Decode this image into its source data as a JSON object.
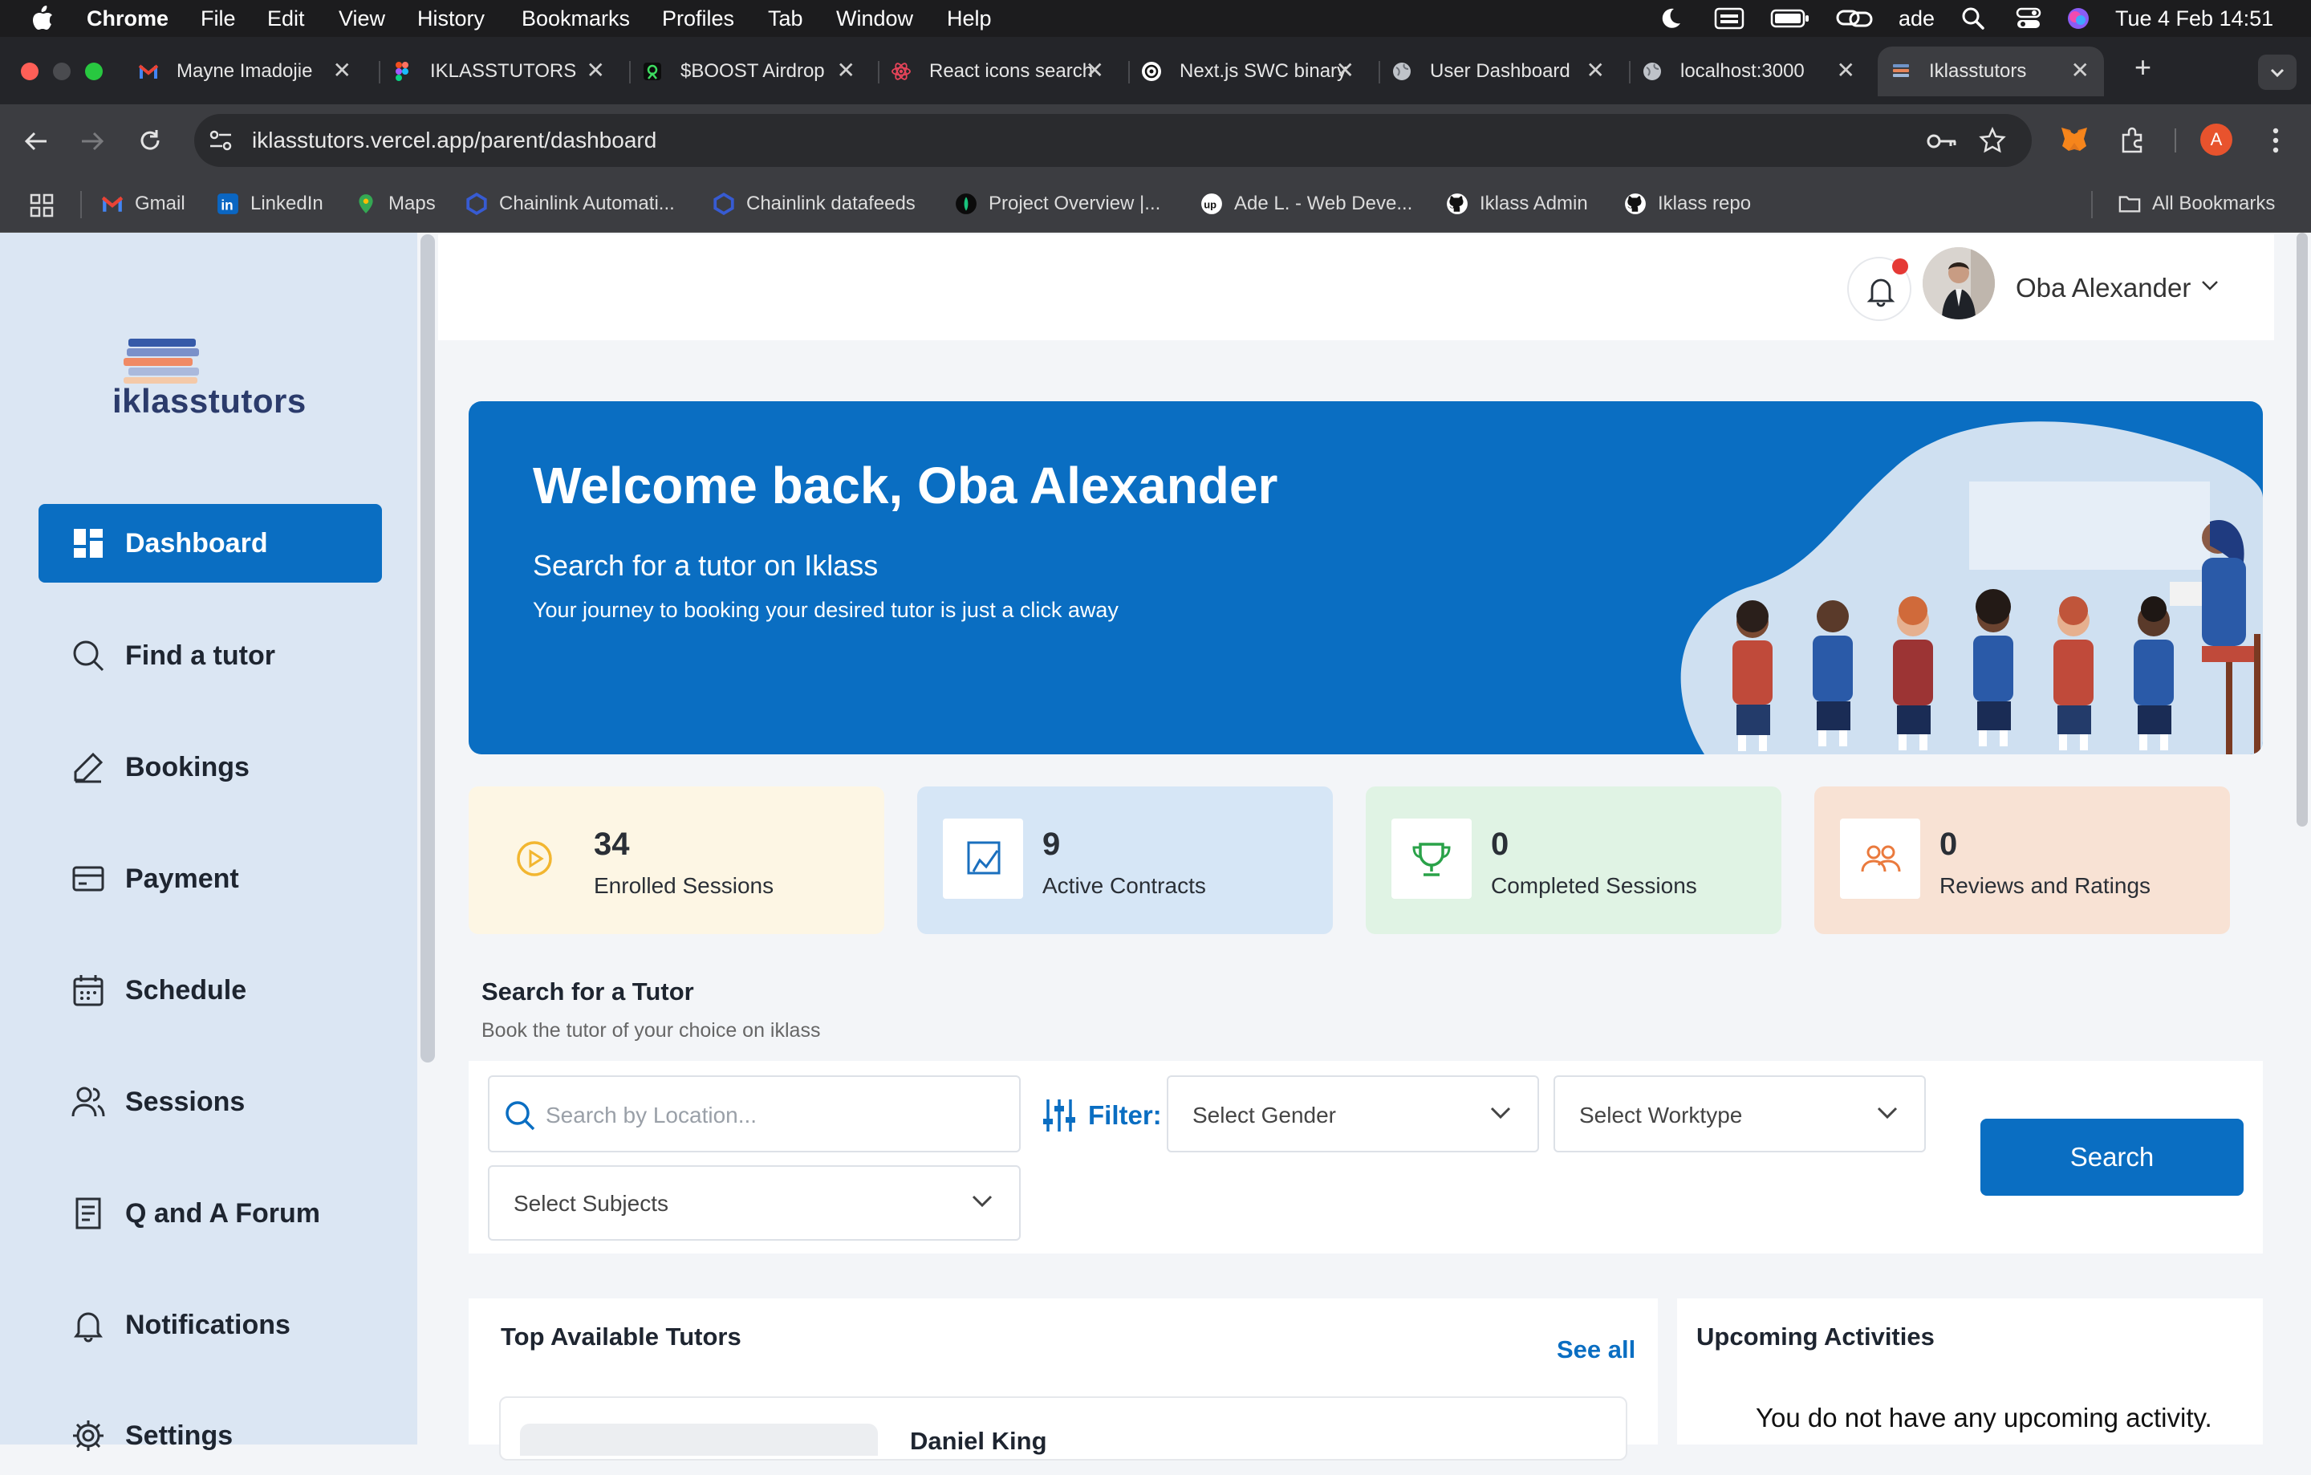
{
  "menubar": {
    "app": "Chrome",
    "items": [
      "File",
      "Edit",
      "View",
      "History",
      "Bookmarks",
      "Profiles",
      "Tab",
      "Window",
      "Help"
    ],
    "user": "ade",
    "datetime": "Tue 4 Feb  14:51"
  },
  "tabs": [
    {
      "title": "Mayne Imadojie",
      "icon": "gmail-icon"
    },
    {
      "title": "IKLASSTUTORS",
      "icon": "figma-icon"
    },
    {
      "title": "$BOOST Airdrop",
      "icon": "boost-icon"
    },
    {
      "title": "React icons search",
      "icon": "react-icon"
    },
    {
      "title": "Next.js SWC binary",
      "icon": "openai-icon"
    },
    {
      "title": "User Dashboard",
      "icon": "globe-icon"
    },
    {
      "title": "localhost:3000",
      "icon": "globe-icon"
    },
    {
      "title": "Iklasstutors",
      "icon": "books-icon",
      "active": true
    }
  ],
  "toolbar": {
    "url": "iklasstutors.vercel.app/parent/dashboard",
    "profile_initial": "A"
  },
  "bookmarks": {
    "items": [
      {
        "label": "Gmail",
        "icon": "gmail-icon"
      },
      {
        "label": "LinkedIn",
        "icon": "linkedin-icon"
      },
      {
        "label": "Maps",
        "icon": "maps-icon"
      },
      {
        "label": "Chainlink Automati...",
        "icon": "chainlink-icon"
      },
      {
        "label": "Chainlink datafeeds",
        "icon": "chainlink-icon"
      },
      {
        "label": "Project Overview |...",
        "icon": "project-icon"
      },
      {
        "label": "Ade L. - Web Deve...",
        "icon": "upwork-icon"
      },
      {
        "label": "Iklass Admin",
        "icon": "github-icon"
      },
      {
        "label": "Iklass repo",
        "icon": "github-icon"
      }
    ],
    "all_label": "All Bookmarks"
  },
  "brand": {
    "name": "iklasstutors"
  },
  "sidebar": {
    "items": [
      {
        "label": "Dashboard",
        "icon": "dashboard-icon",
        "active": true
      },
      {
        "label": "Find a tutor",
        "icon": "search-icon"
      },
      {
        "label": "Bookings",
        "icon": "pencil-icon"
      },
      {
        "label": "Payment",
        "icon": "card-icon"
      },
      {
        "label": "Schedule",
        "icon": "calendar-icon"
      },
      {
        "label": "Sessions",
        "icon": "users-icon"
      },
      {
        "label": "Q and A Forum",
        "icon": "forum-icon"
      },
      {
        "label": "Notifications",
        "icon": "bell-icon"
      },
      {
        "label": "Settings",
        "icon": "gear-icon"
      }
    ]
  },
  "header": {
    "user_name": "Oba Alexander"
  },
  "banner": {
    "welcome": "Welcome back, Oba Alexander",
    "subtitle": "Search for a tutor on Iklass",
    "description": "Your journey to booking your desired tutor is just a click away"
  },
  "stats": [
    {
      "value": "34",
      "label": "Enrolled Sessions",
      "icon": "play-circle-icon",
      "bg": "#fdf6e4",
      "accent": "#f2b630"
    },
    {
      "value": "9",
      "label": "Active Contracts",
      "icon": "contract-icon",
      "bg": "#d6e6f6",
      "accent": "#1a6fbe"
    },
    {
      "value": "0",
      "label": "Completed Sessions",
      "icon": "trophy-icon",
      "bg": "#e0f3e4",
      "accent": "#2aa249"
    },
    {
      "value": "0",
      "label": "Reviews and Ratings",
      "icon": "reviews-icon",
      "bg": "#f8e2d4",
      "accent": "#ea7a3d"
    }
  ],
  "search_section": {
    "title": "Search for a Tutor",
    "subtitle": "Book the tutor of your choice on iklass",
    "location_placeholder": "Search by Location...",
    "filter_label": "Filter:",
    "gender": "Select Gender",
    "worktype": "Select Worktype",
    "subjects": "Select Subjects",
    "search_button": "Search"
  },
  "top_tutors": {
    "title": "Top Available Tutors",
    "see_all": "See all",
    "first_name": "Daniel King"
  },
  "upcoming": {
    "title": "Upcoming Activities",
    "empty": "You do not have any upcoming activity."
  },
  "colors": {
    "primary": "#0a6ec2",
    "sidebar_bg": "#dbe6f3",
    "page_bg": "#f3f5f8"
  }
}
